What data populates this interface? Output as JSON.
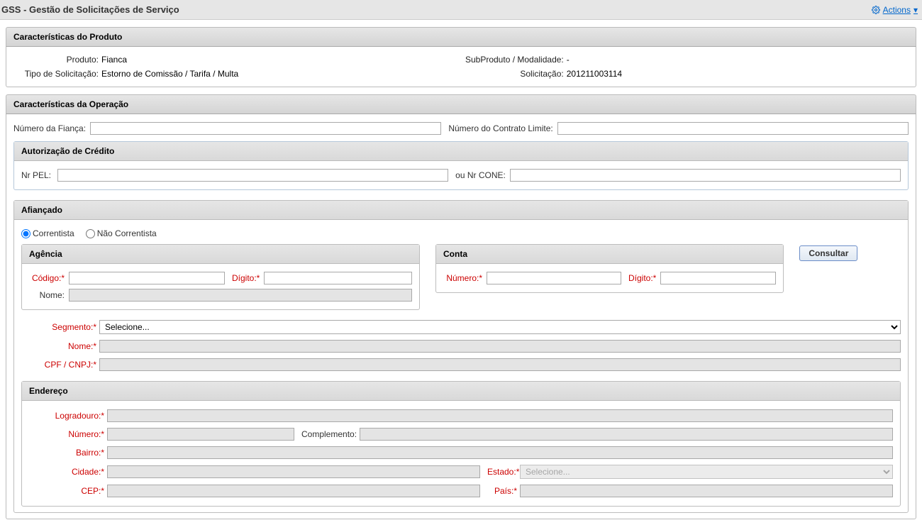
{
  "header": {
    "title": "GSS - Gestão de Solicitações de Serviço",
    "actions_label": "Actions"
  },
  "produto": {
    "section_title": "Características do Produto",
    "produto_label": "Produto:",
    "produto_value": "Fianca",
    "subproduto_label": "SubProduto / Modalidade:",
    "subproduto_value": "-",
    "tipo_label": "Tipo de Solicitação:",
    "tipo_value": "Estorno de Comissão / Tarifa / Multa",
    "solicitacao_label": "Solicitação:",
    "solicitacao_value": "201211003114"
  },
  "operacao": {
    "section_title": "Características da Operação",
    "num_fianca_label": "Número da Fiança:",
    "num_fianca_value": "",
    "num_contrato_label": "Número do Contrato Limite:",
    "num_contrato_value": ""
  },
  "credito": {
    "section_title": "Autorização de Crédito",
    "nrpel_label": "Nr PEL:",
    "nrpel_value": "",
    "ou_label": "ou Nr CONE:",
    "ou_value": ""
  },
  "afian": {
    "section_title": "Afiançado",
    "radio_correntista": "Correntista",
    "radio_nao": "Não Correntista",
    "btn_consultar": "Consultar",
    "agencia": {
      "title": "Agência",
      "codigo_label": "Código:*",
      "codigo_value": "",
      "digito_label": "Dígito:*",
      "digito_value": "",
      "nome_label": "Nome:",
      "nome_value": ""
    },
    "conta": {
      "title": "Conta",
      "numero_label": "Número:*",
      "numero_value": "",
      "digito_label": "Dígito:*",
      "digito_value": ""
    },
    "segmento_label": "Segmento:*",
    "segmento_value": "Selecione...",
    "nome_label": "Nome:*",
    "nome_value": "",
    "cpf_label": "CPF / CNPJ:*",
    "cpf_value": ""
  },
  "endereco": {
    "section_title": "Endereço",
    "logradouro_label": "Logradouro:*",
    "logradouro_value": "",
    "numero_label": "Número:*",
    "numero_value": "",
    "complemento_label": "Complemento:",
    "complemento_value": "",
    "bairro_label": "Bairro:*",
    "bairro_value": "",
    "cidade_label": "Cidade:*",
    "cidade_value": "",
    "estado_label": "Estado:*",
    "estado_value": "Selecione...",
    "cep_label": "CEP:*",
    "cep_value": "",
    "pais_label": "País:*",
    "pais_value": ""
  }
}
